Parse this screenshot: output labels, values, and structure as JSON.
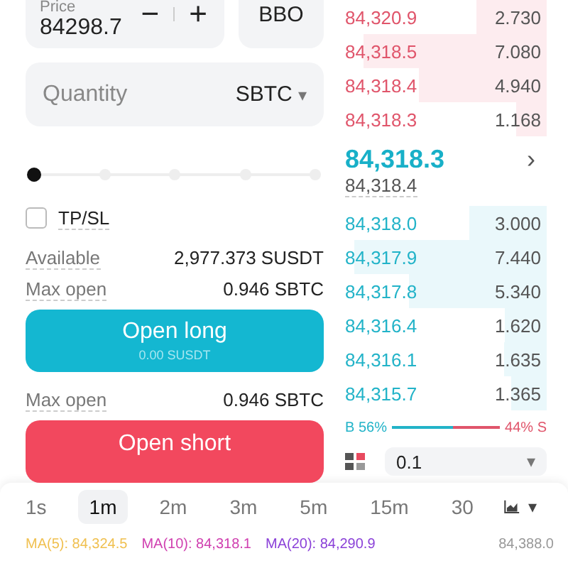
{
  "order_form": {
    "price": {
      "label": "Price",
      "value": "84298.7",
      "minus": "−",
      "plus": "+"
    },
    "bbo_button": "BBO",
    "quantity": {
      "placeholder": "Quantity",
      "unit": "SBTC",
      "caret": "▾"
    },
    "slider": {
      "level": 0
    },
    "tpsl": {
      "label": "TP/SL",
      "checked": false
    },
    "available": {
      "label": "Available",
      "value": "2,977.373 SUSDT"
    },
    "max_open_long": {
      "label": "Max open",
      "value": "0.946 SBTC"
    },
    "open_long": {
      "label": "Open long",
      "amount": "0.00 SUSDT"
    },
    "max_open_short": {
      "label": "Max open",
      "value": "0.946 SBTC"
    },
    "open_short": {
      "label": "Open short"
    }
  },
  "order_book": {
    "asks": [
      {
        "price": "84,320.9",
        "qty": "2.730"
      },
      {
        "price": "84,318.5",
        "qty": "7.080"
      },
      {
        "price": "84,318.4",
        "qty": "4.940"
      },
      {
        "price": "84,318.3",
        "qty": "1.168"
      }
    ],
    "last_price": "84,318.3",
    "mark_price": "84,318.4",
    "more": "›",
    "bids": [
      {
        "price": "84,318.0",
        "qty": "3.000"
      },
      {
        "price": "84,317.9",
        "qty": "7.440"
      },
      {
        "price": "84,317.8",
        "qty": "5.340"
      },
      {
        "price": "84,316.4",
        "qty": "1.620"
      },
      {
        "price": "84,316.1",
        "qty": "1.635"
      },
      {
        "price": "84,315.7",
        "qty": "1.365"
      }
    ],
    "ratio": {
      "buy": "B 56%",
      "sell": "44% S",
      "level": 0.56
    },
    "precision": {
      "value": "0.1",
      "caret": "▾"
    }
  },
  "chart_sheet": {
    "intervals": [
      {
        "label": "1s",
        "selected": false
      },
      {
        "label": "1m",
        "selected": true
      },
      {
        "label": "2m",
        "selected": false
      },
      {
        "label": "3m",
        "selected": false
      },
      {
        "label": "5m",
        "selected": false
      },
      {
        "label": "15m",
        "selected": false
      },
      {
        "label": "30",
        "selected": false
      }
    ],
    "more_caret": "▾",
    "indicators": [
      {
        "text": "MA(5): 84,324.5",
        "color": "#f0c050"
      },
      {
        "text": "MA(10): 84,318.1",
        "color": "#d040b0"
      },
      {
        "text": "MA(20): 84,290.9",
        "color": "#8a40d8"
      }
    ],
    "axis_value": "84,388.0"
  }
}
